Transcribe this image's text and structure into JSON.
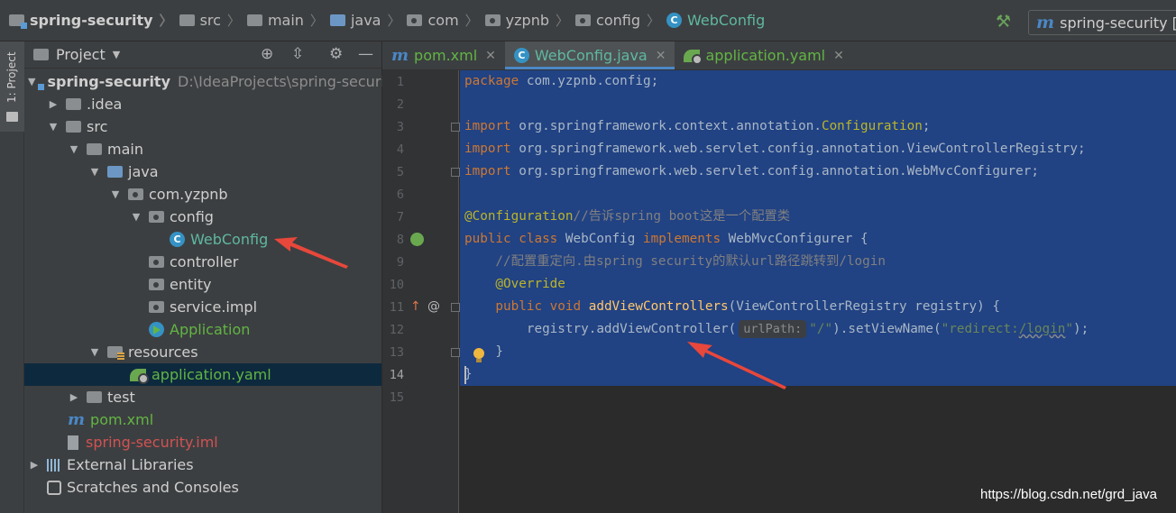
{
  "breadcrumb": [
    "spring-security",
    "src",
    "main",
    "java",
    "com",
    "yzpnb",
    "config",
    "WebConfig"
  ],
  "run_config": "spring-security [cl",
  "strip_label": "1: Project",
  "project_panel": {
    "title": "Project",
    "tree": [
      {
        "label": "spring-security",
        "extra": "D:\\IdeaProjects\\spring-security"
      },
      {
        "label": ".idea"
      },
      {
        "label": "src"
      },
      {
        "label": "main"
      },
      {
        "label": "java"
      },
      {
        "label": "com.yzpnb"
      },
      {
        "label": "config"
      },
      {
        "label": "WebConfig"
      },
      {
        "label": "controller"
      },
      {
        "label": "entity"
      },
      {
        "label": "service.impl"
      },
      {
        "label": "Application"
      },
      {
        "label": "resources"
      },
      {
        "label": "application.yaml"
      },
      {
        "label": "test"
      },
      {
        "label": "pom.xml"
      },
      {
        "label": "spring-security.iml"
      },
      {
        "label": "External Libraries"
      },
      {
        "label": "Scratches and Consoles"
      }
    ]
  },
  "tabs": [
    {
      "label": "pom.xml"
    },
    {
      "label": "WebConfig.java"
    },
    {
      "label": "application.yaml"
    }
  ],
  "editor": {
    "line_numbers": [
      "1",
      "2",
      "3",
      "4",
      "5",
      "6",
      "7",
      "8",
      "9",
      "10",
      "11",
      "12",
      "13",
      "14",
      "15"
    ],
    "lines": {
      "l1": {
        "kw": "package",
        "rest": " com.yzpnb.config;"
      },
      "l3": {
        "kw": "import",
        "pre": " org.springframework.context.annotation.",
        "cls": "Configuration",
        "post": ";"
      },
      "l4": {
        "kw": "import",
        "rest": " org.springframework.web.servlet.config.annotation.ViewControllerRegistry;"
      },
      "l5": {
        "kw": "import",
        "rest": " org.springframework.web.servlet.config.annotation.WebMvcConfigurer;"
      },
      "l7": {
        "ann": "@Configuration",
        "cmt": "//告诉spring boot这是一个配置类"
      },
      "l8": {
        "kw1": "public class",
        "name": " WebConfig ",
        "kw2": "implements",
        "rest": " WebMvcConfigurer {"
      },
      "l9": {
        "cmt": "    //配置重定向.由spring security的默认url路径跳转到/login"
      },
      "l10": {
        "ann": "    @Override"
      },
      "l11": {
        "kw": "    public void ",
        "mth": "addViewControllers",
        "rest": "(ViewControllerRegistry registry) {"
      },
      "l12": {
        "pre": "        registry.addViewController(",
        "hint": "urlPath:",
        "str1": "\"/\"",
        "mid": ").setViewName(",
        "str2a": "\"redirect:",
        "str2b": "/login",
        "str2c": "\"",
        "post": ");"
      },
      "l13": {
        "rest": "    }"
      },
      "l14": {
        "rest": "}"
      }
    }
  },
  "watermark": "https://blog.csdn.net/grd_java",
  "colors": {
    "selection": "#214283",
    "keyword": "#cc7832",
    "annotation": "#bbb529",
    "string": "#6a8759",
    "comment": "#808080",
    "arrow": "#e8473b"
  }
}
